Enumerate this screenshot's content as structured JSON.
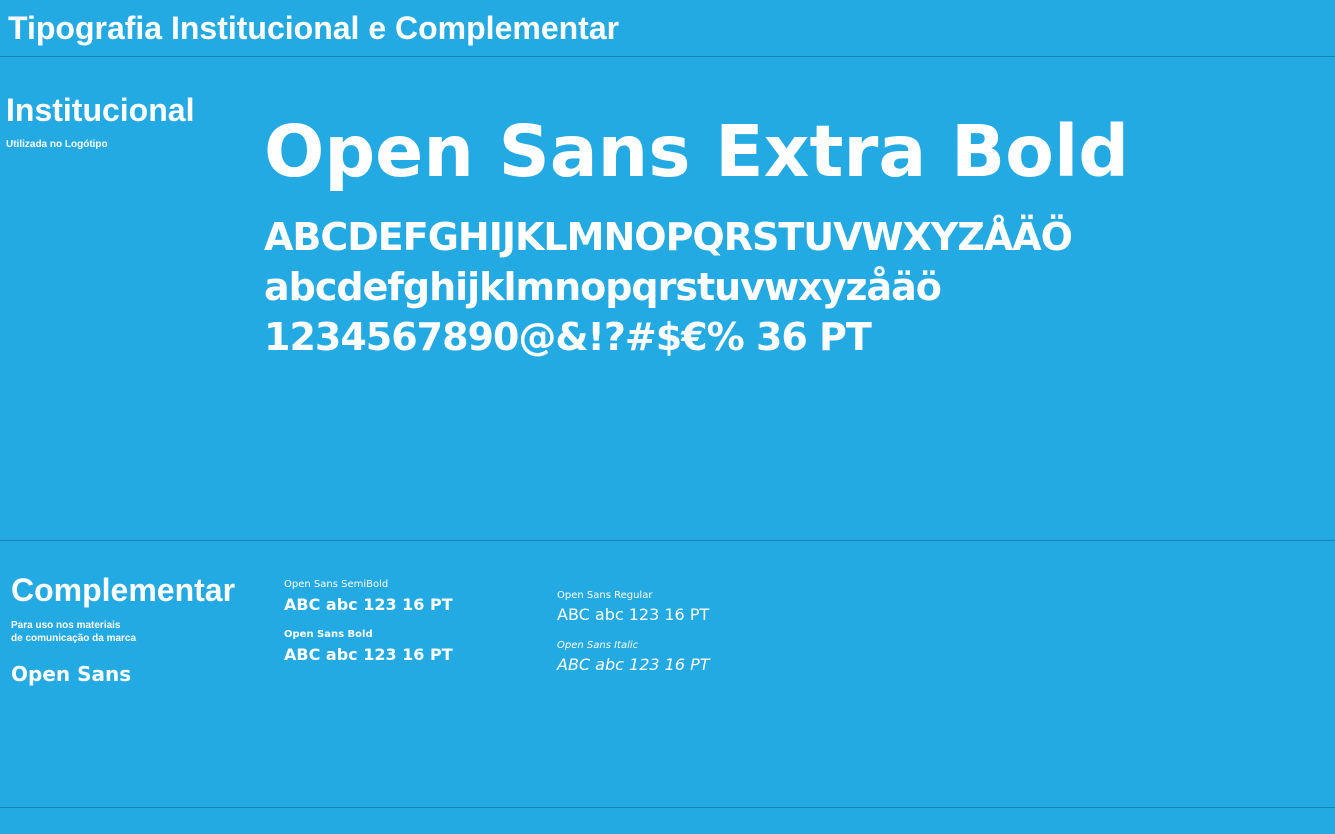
{
  "header": {
    "title": "Tipografia Institucional e Complementar"
  },
  "institutional": {
    "heading": "Institucional",
    "subtitle": "Utilizada no Logótipo",
    "font_name": "Open Sans Extra Bold",
    "glyphs_upper": "ABCDEFGHIJKLMNOPQRSTUVWXYZÅÄÖ",
    "glyphs_lower": "abcdefghijklmnopqrstuvwxyzåäö",
    "glyphs_digits": "1234567890@&!?#$€% 36 PT"
  },
  "complementary": {
    "heading": "Complementar",
    "description_line1": "Para uso nos materiais",
    "description_line2": "de comunicação da marca",
    "font_family": "Open Sans",
    "samples": [
      {
        "label": "Open Sans SemiBold",
        "text": "ABC abc 123 16 PT"
      },
      {
        "label": "Open Sans Bold",
        "text": "ABC abc 123 16 PT"
      },
      {
        "label": "Open Sans Regular",
        "text": "ABC abc 123 16 PT"
      },
      {
        "label": "Open Sans Italic",
        "text": "ABC abc 123 16 PT"
      }
    ]
  },
  "colors": {
    "background": "#24aae2",
    "text": "#ffffff"
  }
}
